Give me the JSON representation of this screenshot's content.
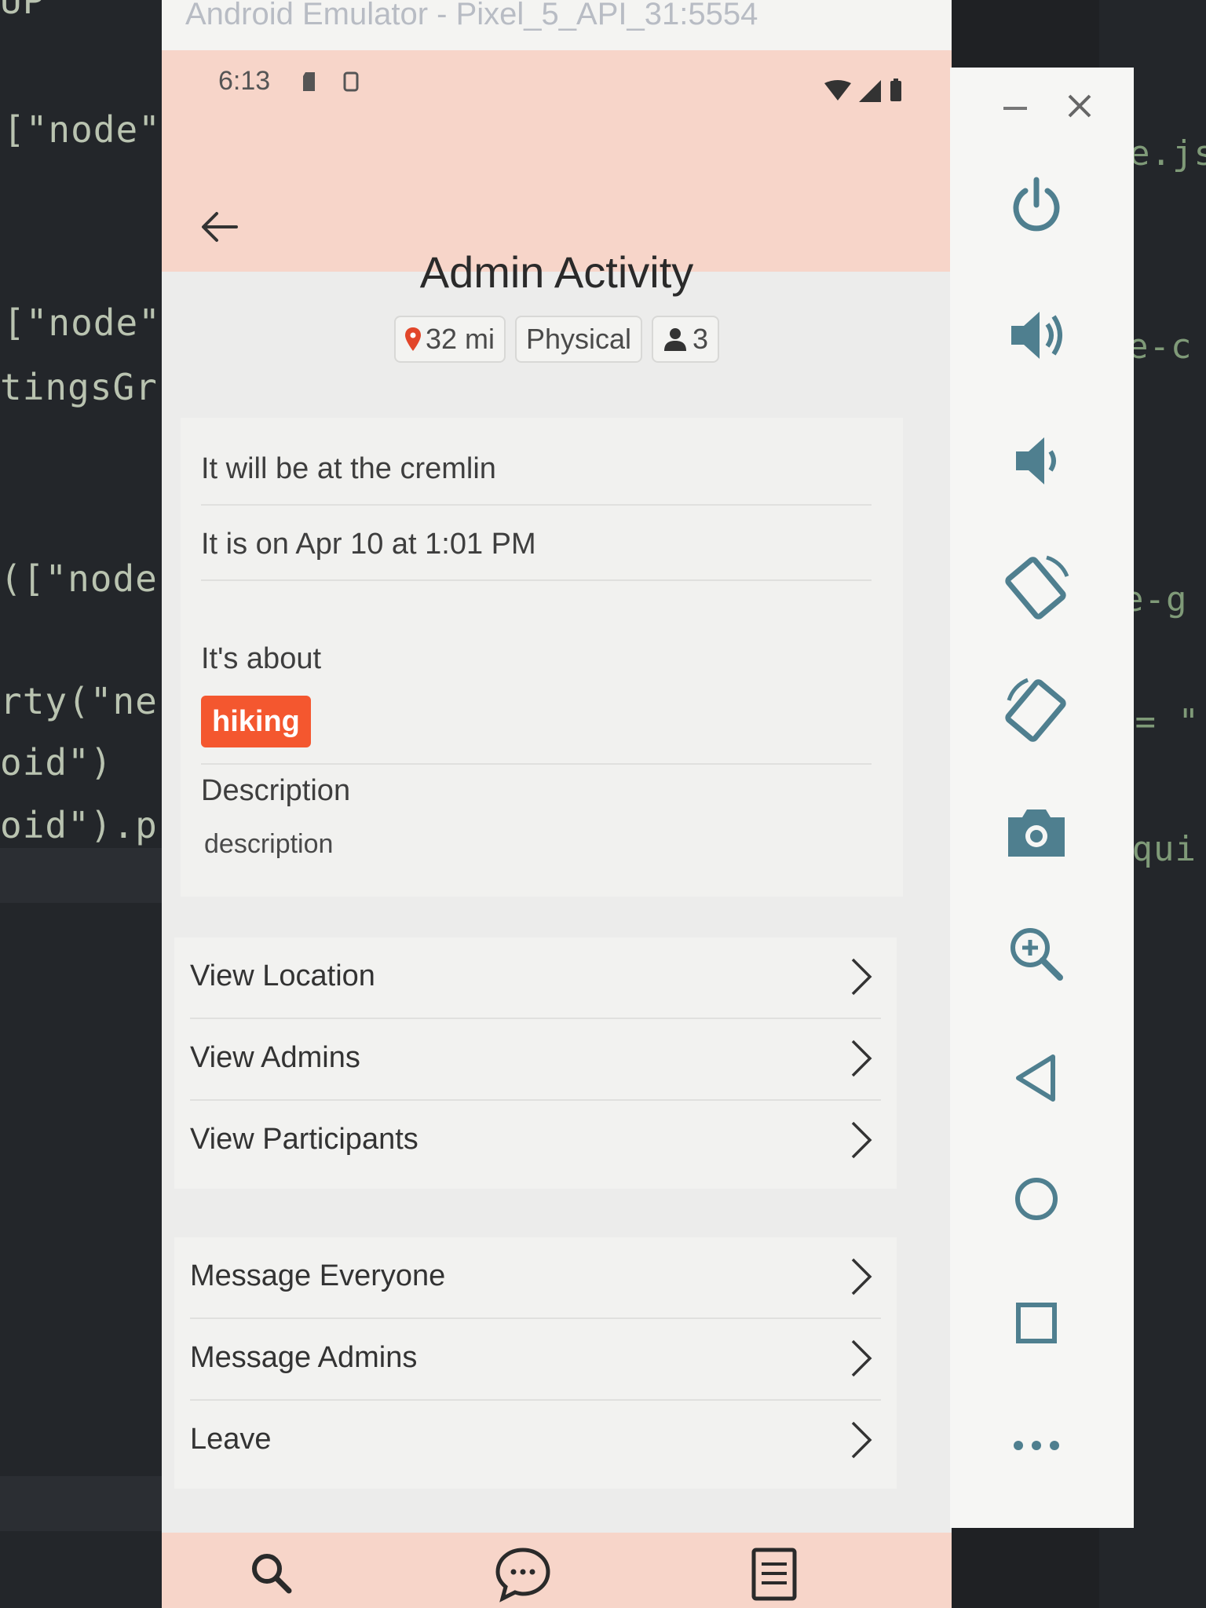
{
  "background_code": {
    "left_lines": [
      "UP",
      "[\"node\"",
      "[\"node\"",
      "tingsGr",
      "([\"node",
      "rty(\"ne",
      "oid\")",
      "oid\").p"
    ],
    "right_lines": [
      "e.js",
      "e-c",
      "e-g",
      "== \"",
      "equi"
    ]
  },
  "emulator": {
    "window_title": "Android Emulator - Pixel_5_API_31:5554"
  },
  "status_bar": {
    "time": "6:13"
  },
  "header": {
    "title": "Admin Activity"
  },
  "chips": {
    "distance": "32 mi",
    "type": "Physical",
    "participants": "3"
  },
  "details": {
    "location_text": "It will be at the cremlin",
    "date_text": "It is on Apr 10 at 1:01 PM",
    "about_label": "It's about",
    "tag": "hiking",
    "description_label": "Description",
    "description_value": "description"
  },
  "actions_group_1": [
    "View Location",
    "View Admins",
    "View Participants"
  ],
  "actions_group_2": [
    "Message Everyone",
    "Message Admins",
    "Leave"
  ],
  "colors": {
    "app_bar": "#f7d5c9",
    "tag": "#f4572f",
    "toolbar_icon": "#4f7f8f",
    "location_pin": "#e2462a"
  }
}
